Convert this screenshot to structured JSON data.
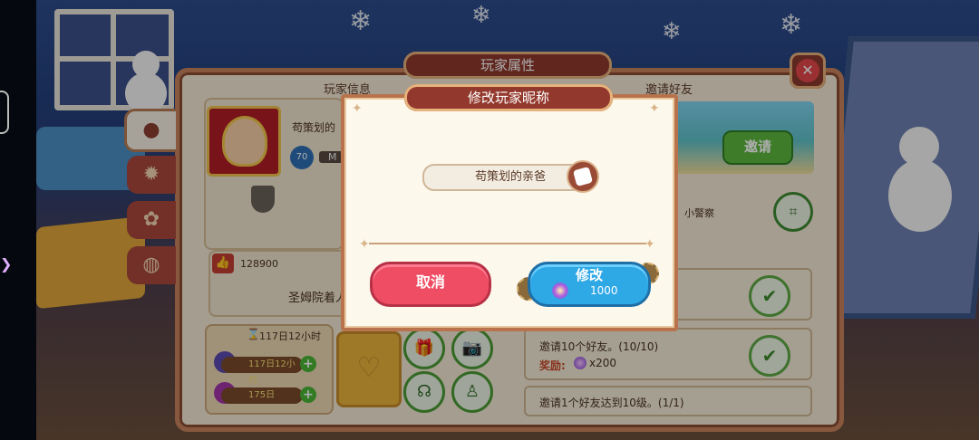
{
  "panel": {
    "title": "玩家属性",
    "close_icon": "close-icon"
  },
  "player_info": {
    "section_label": "玩家信息",
    "name_partial": "苟策划的",
    "level": "70",
    "level_suffix": "M",
    "likes": "128900",
    "signature_partial": "圣姆院着人"
  },
  "timers": {
    "header": "117日12小时",
    "row1": "117日12小时",
    "row2": "175日"
  },
  "invite": {
    "section_label": "邀请好友",
    "invite_button": "邀请",
    "small_label": "小警察",
    "tasks": [
      {
        "text": "邀请10个好友。(10/10)",
        "reward_label": "奖励:",
        "reward_value": "x200"
      },
      {
        "text": "邀请1个好友达到10级。(1/1)"
      }
    ]
  },
  "dialog": {
    "title": "修改玩家昵称",
    "nickname_value": "苟策划的亲爸",
    "cancel_label": "取消",
    "confirm_label": "修改",
    "cost": "1000"
  }
}
